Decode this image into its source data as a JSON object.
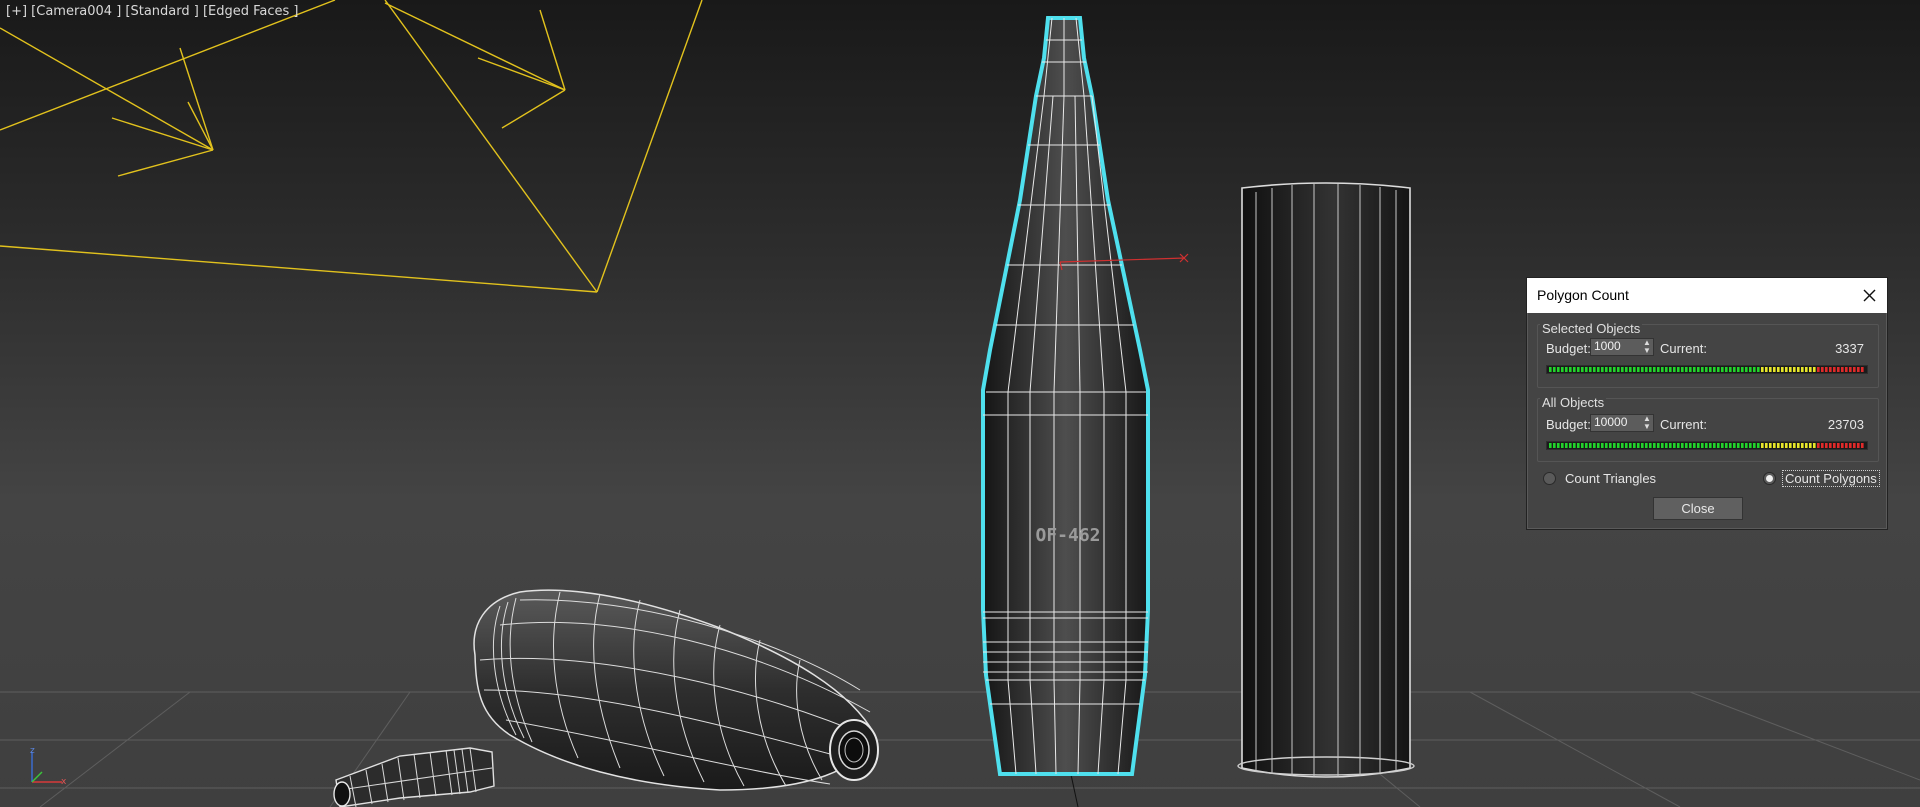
{
  "viewport": {
    "label": "[+] [Camera004 ] [Standard ] [Edged Faces ]",
    "shell_marking": "OF-462",
    "axis": {
      "x": "x",
      "z": "z"
    }
  },
  "dialog": {
    "title": "Polygon Count",
    "selected_objects": {
      "group_label": "Selected Objects",
      "budget_label": "Budget:",
      "budget_value": "1000",
      "current_label": "Current:",
      "current_value": "3337"
    },
    "all_objects": {
      "group_label": "All Objects",
      "budget_label": "Budget:",
      "budget_value": "10000",
      "current_label": "Current:",
      "current_value": "23703"
    },
    "count_triangles_label": "Count Triangles",
    "count_polygons_label": "Count Polygons",
    "selected_mode": "polygons",
    "close_label": "Close"
  },
  "colors": {
    "selection_outline": "#4fe0ee",
    "light_helper": "#e2c21d",
    "meter_green": "#22d42b",
    "meter_yellow": "#e6e62a",
    "meter_red": "#e02a2a"
  }
}
